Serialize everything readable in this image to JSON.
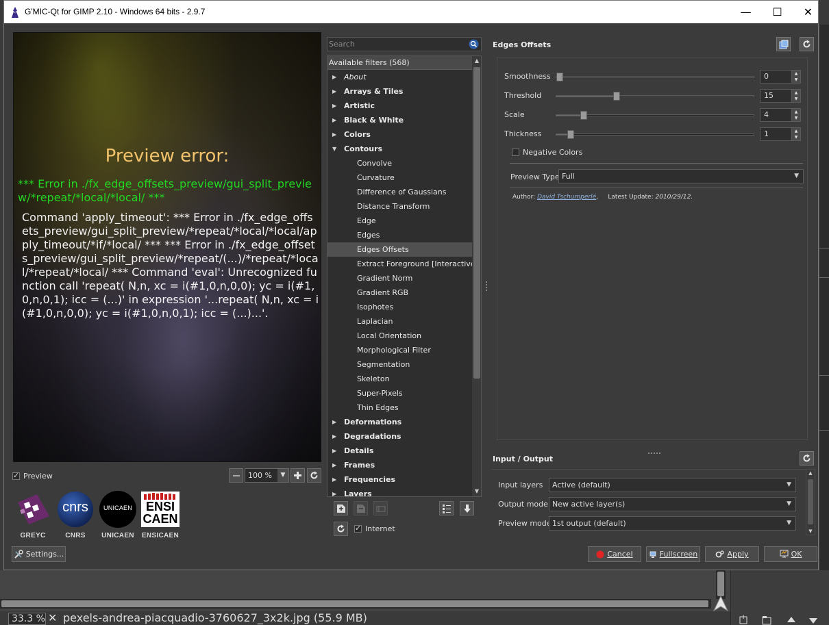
{
  "window": {
    "title": "G'MIC-Qt for GIMP 2.10 - Windows 64 bits - 2.9.7",
    "minimize": "—",
    "maximize": "☐",
    "close": "✕"
  },
  "preview": {
    "error_title": "Preview error:",
    "error_green": "*** Error in ./fx_edge_offsets_preview/gui_split_preview/*repeat/*local/*local/ ***",
    "error_body": "Command 'apply_timeout': *** Error in ./fx_edge_offsets_preview/gui_split_preview/*repeat/*local/*local/apply_timeout/*if/*local/ *** *** Error in ./fx_edge_offsets_preview/gui_split_preview/*repeat/(...)/*repeat/*local/*repeat/*local/ *** Command 'eval': Unrecognized function call 'repeat( N,n, xc = i(#1,0,n,0,0); yc = i(#1,0,n,0,1); icc = (...)' in expression '...repeat( N,n, xc = i(#1,0,n,0,0); yc = i(#1,0,n,0,1); icc = (...)...'.",
    "checkbox_label": "Preview",
    "zoom_value": "100 %"
  },
  "logos": [
    {
      "name": "GREYC"
    },
    {
      "name": "CNRS"
    },
    {
      "name": "UNICAEN"
    },
    {
      "name": "ENSICAEN"
    }
  ],
  "logo_text": {
    "cnrs": "cnrs",
    "unicaen": "UNICAEN",
    "ensi": "ENSI",
    "caen": "CAEN"
  },
  "buttons": {
    "settings": "Settings...",
    "cancel": "Cancel",
    "fullscreen": "Fullscreen",
    "apply": "Apply",
    "ok": "OK"
  },
  "filters": {
    "search_placeholder": "Search",
    "header": "Available filters (568)",
    "internet_label": "Internet",
    "items": [
      {
        "label": "About",
        "type": "cat-italic"
      },
      {
        "label": "Arrays & Tiles",
        "type": "cat"
      },
      {
        "label": "Artistic",
        "type": "cat"
      },
      {
        "label": "Black & White",
        "type": "cat"
      },
      {
        "label": "Colors",
        "type": "cat"
      },
      {
        "label": "Contours",
        "type": "cat-open"
      },
      {
        "label": "Convolve",
        "type": "sub"
      },
      {
        "label": "Curvature",
        "type": "sub"
      },
      {
        "label": "Difference of Gaussians",
        "type": "sub"
      },
      {
        "label": "Distance Transform",
        "type": "sub"
      },
      {
        "label": "Edge",
        "type": "sub"
      },
      {
        "label": "Edges",
        "type": "sub"
      },
      {
        "label": "Edges Offsets",
        "type": "sub-sel"
      },
      {
        "label": "Extract Foreground [Interactive]",
        "type": "sub"
      },
      {
        "label": "Gradient Norm",
        "type": "sub"
      },
      {
        "label": "Gradient RGB",
        "type": "sub"
      },
      {
        "label": "Isophotes",
        "type": "sub"
      },
      {
        "label": "Laplacian",
        "type": "sub"
      },
      {
        "label": "Local Orientation",
        "type": "sub"
      },
      {
        "label": "Morphological Filter",
        "type": "sub"
      },
      {
        "label": "Segmentation",
        "type": "sub"
      },
      {
        "label": "Skeleton",
        "type": "sub"
      },
      {
        "label": "Super-Pixels",
        "type": "sub"
      },
      {
        "label": "Thin Edges",
        "type": "sub"
      },
      {
        "label": "Deformations",
        "type": "cat"
      },
      {
        "label": "Degradations",
        "type": "cat"
      },
      {
        "label": "Details",
        "type": "cat"
      },
      {
        "label": "Frames",
        "type": "cat"
      },
      {
        "label": "Frequencies",
        "type": "cat"
      },
      {
        "label": "Layers",
        "type": "cat"
      }
    ]
  },
  "params": {
    "title": "Edges Offsets",
    "sliders": [
      {
        "label": "Smoothness",
        "value": "0",
        "fraction": 0.0
      },
      {
        "label": "Threshold",
        "value": "15",
        "fraction": 0.305
      },
      {
        "label": "Scale",
        "value": "4",
        "fraction": 0.137
      },
      {
        "label": "Thickness",
        "value": "1",
        "fraction": 0.074
      }
    ],
    "negative_colors": "Negative Colors",
    "preview_type_label": "Preview Type",
    "preview_type_value": "Full",
    "author_label": "Author:",
    "author_name": "David Tschumperlé",
    "update_label": "Latest Update:",
    "update_value": "2010/29/12."
  },
  "io": {
    "title": "Input / Output",
    "rows": [
      {
        "label": "Input layers",
        "value": "Active (default)"
      },
      {
        "label": "Output mode",
        "value": "New active layer(s)"
      },
      {
        "label": "Preview mode",
        "value": "1st output (default)"
      }
    ]
  },
  "gimp": {
    "zoom": "33.3 %",
    "close": "✕",
    "filename": "pexels-andrea-piacquadio-3760627_3x2k.jpg (55.9 MB)"
  }
}
